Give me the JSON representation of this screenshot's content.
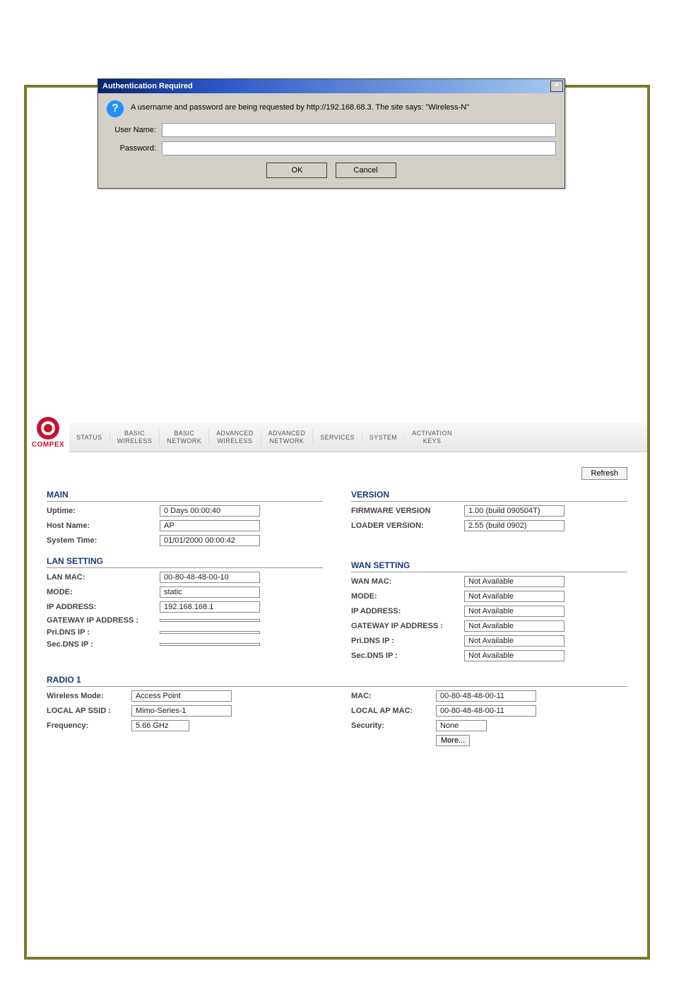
{
  "dialog": {
    "title": "Authentication Required",
    "message": "A username and password are being requested by http://192.168.68.3. The site says: \"Wireless-N\"",
    "user_label": "User Name:",
    "pass_label": "Password:",
    "ok": "OK",
    "cancel": "Cancel",
    "user_value": "",
    "pass_value": ""
  },
  "logo": "COMPEX",
  "tabs": [
    "STATUS",
    "BASIC\nWIRELESS",
    "BASIC\nNETWORK",
    "ADVANCED\nWIRELESS",
    "ADVANCED\nNETWORK",
    "SERVICES",
    "SYSTEM",
    "ACTIVATION\nKEYS"
  ],
  "refresh": "Refresh",
  "sections": {
    "main": "MAIN",
    "version": "VERSION",
    "lan": "LAN SETTING",
    "wan": "WAN SETTING",
    "radio1": "RADIO 1"
  },
  "main": {
    "uptime_k": "Uptime:",
    "uptime_v": "0 Days 00:00:40",
    "host_k": "Host Name:",
    "host_v": "AP",
    "systime_k": "System Time:",
    "systime_v": "01/01/2000 00:00:42"
  },
  "version": {
    "fw_k": "FIRMWARE VERSION",
    "fw_v": "1.00 (build 090504T)",
    "ld_k": "LOADER VERSION:",
    "ld_v": "2.55 (build 0902)"
  },
  "lan": {
    "mac_k": "LAN MAC:",
    "mac_v": "00-80-48-48-00-10",
    "mode_k": "MODE:",
    "mode_v": "static",
    "ip_k": "IP ADDRESS:",
    "ip_v": "192.168.168.1",
    "gw_k": "GATEWAY IP ADDRESS :",
    "gw_v": "",
    "pdns_k": "Pri.DNS IP :",
    "pdns_v": "",
    "sdns_k": "Sec.DNS IP :",
    "sdns_v": ""
  },
  "wan": {
    "mac_k": "WAN MAC:",
    "mac_v": "Not Available",
    "mode_k": "MODE:",
    "mode_v": "Not Available",
    "ip_k": "IP ADDRESS:",
    "ip_v": "Not Available",
    "gw_k": "GATEWAY IP ADDRESS :",
    "gw_v": "Not Available",
    "pdns_k": "Pri.DNS IP :",
    "pdns_v": "Not Available",
    "sdns_k": "Sec.DNS IP :",
    "sdns_v": "Not Available"
  },
  "radio1": {
    "wmode_k": "Wireless Mode:",
    "wmode_v": "Access Point",
    "ssid_k": "LOCAL AP SSID :",
    "ssid_v": "Mimo-Series-1",
    "freq_k": "Frequency:",
    "freq_v": "5.66 GHz",
    "mac_k": "MAC:",
    "mac_v": "00-80-48-48-00-11",
    "apmac_k": "LOCAL AP MAC:",
    "apmac_v": "00-80-48-48-00-11",
    "sec_k": "Security:",
    "sec_v": "None",
    "more": "More..."
  }
}
